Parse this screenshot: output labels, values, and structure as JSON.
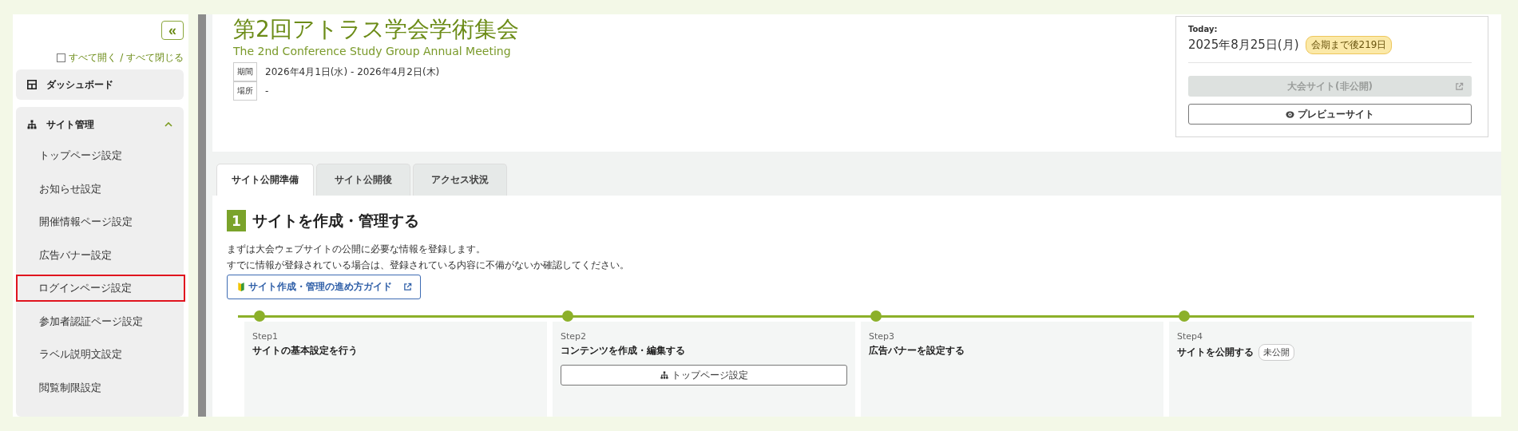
{
  "sidebar": {
    "collapse_button": "«",
    "expand_all": {
      "label": "すべて開く / すべて閉じる",
      "checked": false
    },
    "items": [
      {
        "kind": "dashboard",
        "label": "ダッシュボード"
      },
      {
        "kind": "group",
        "label": "サイト管理",
        "expanded": true,
        "children": [
          {
            "label": "トップページ設定",
            "highlighted": false
          },
          {
            "label": "お知らせ設定",
            "highlighted": false
          },
          {
            "label": "開催情報ページ設定",
            "highlighted": false
          },
          {
            "label": "広告バナー設定",
            "highlighted": false
          },
          {
            "label": "ログインページ設定",
            "highlighted": true
          },
          {
            "label": "参加者認証ページ設定",
            "highlighted": false
          },
          {
            "label": "ラベル説明文設定",
            "highlighted": false
          },
          {
            "label": "閲覧制限設定",
            "highlighted": false
          }
        ]
      }
    ]
  },
  "header": {
    "title": "第2回アトラス学会学術集会",
    "subtitle": "The 2nd Conference Study Group Annual Meeting",
    "meta": [
      {
        "label": "期間",
        "value": "2026年4月1日(水) - 2026年4月2日(木)"
      },
      {
        "label": "場所",
        "value": "-"
      }
    ]
  },
  "today": {
    "label": "Today:",
    "date": "2025年8月25日(月)",
    "badge": "会期まで後219日",
    "buttons": [
      {
        "kind": "external",
        "label": "大会サイト(非公開)",
        "disabled": true
      },
      {
        "kind": "preview",
        "label": "プレビューサイト",
        "disabled": false
      }
    ]
  },
  "tabs": [
    {
      "label": "サイト公開準備",
      "selected": true
    },
    {
      "label": "サイト公開後",
      "selected": false
    },
    {
      "label": "アクセス状況",
      "selected": false
    }
  ],
  "section": {
    "number": "1",
    "heading": "サイトを作成・管理する",
    "description": [
      "まずは大会ウェブサイトの公開に必要な情報を登録します。",
      "すでに情報が登録されている場合は、登録されている内容に不備がないか確認してください。"
    ],
    "guide_link": "サイト作成・管理の進め方ガイド",
    "steps": [
      {
        "step": "Step1",
        "title": "サイトの基本設定を行う"
      },
      {
        "step": "Step2",
        "title": "コンテンツを作成・編集する",
        "buttons": [
          "トップページ設定"
        ]
      },
      {
        "step": "Step3",
        "title": "広告バナーを設定する"
      },
      {
        "step": "Step4",
        "title": "サイトを公開する",
        "badge": "未公開"
      }
    ]
  }
}
